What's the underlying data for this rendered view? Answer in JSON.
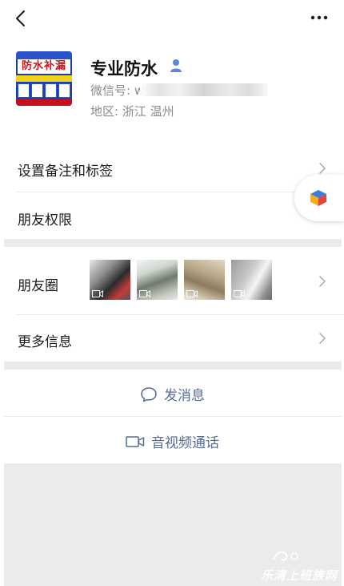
{
  "profile": {
    "name": "专业防水",
    "wechat_label": "微信号: w",
    "region": "地区:  浙江  温州",
    "avatar_text": "防水补漏"
  },
  "rows": {
    "remark": "设置备注和标签",
    "permissions": "朋友权限",
    "moments": "朋友圈",
    "more_info": "更多信息"
  },
  "actions": {
    "message": "发消息",
    "call": "音视频通话"
  },
  "watermark": "乐清上班族网",
  "colors": {
    "link": "#576b95",
    "separator": "#ebebeb"
  },
  "icons": {
    "back": "chevron-left-icon",
    "more": "more-dots-icon",
    "user": "user-icon",
    "chevron": "chevron-right-icon",
    "chat": "chat-bubble-icon",
    "video": "video-camera-icon"
  }
}
